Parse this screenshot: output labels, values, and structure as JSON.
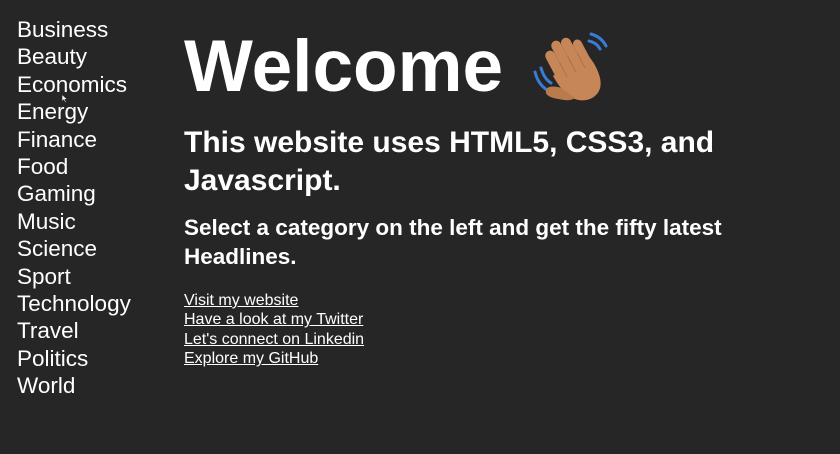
{
  "sidebar": {
    "items": [
      {
        "label": "Business"
      },
      {
        "label": "Beauty"
      },
      {
        "label": "Economics"
      },
      {
        "label": "Energy"
      },
      {
        "label": "Finance"
      },
      {
        "label": "Food"
      },
      {
        "label": "Gaming"
      },
      {
        "label": "Music"
      },
      {
        "label": "Science"
      },
      {
        "label": "Sport"
      },
      {
        "label": "Technology"
      },
      {
        "label": "Travel"
      },
      {
        "label": "Politics"
      },
      {
        "label": "World"
      }
    ]
  },
  "main": {
    "title": "Welcome",
    "title_icon": "waving-hand-icon",
    "subtitle": "This website uses HTML5, CSS3, and Javascript.",
    "prompt": "Select a category on the left and get the fifty latest Headlines.",
    "links": [
      {
        "label": "Visit my website"
      },
      {
        "label": "Have a look at my Twitter"
      },
      {
        "label": "Let's connect on Linkedin"
      },
      {
        "label": "Explore my GitHub"
      }
    ]
  },
  "colors": {
    "background": "#262626",
    "text": "#ffffff",
    "hand": "#c68658"
  }
}
